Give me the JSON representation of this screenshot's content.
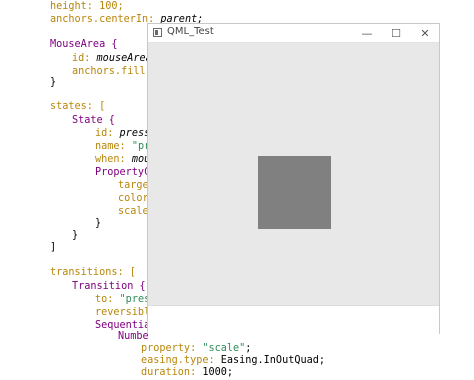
{
  "code": {
    "l1": "height: 100;",
    "l2a": "anchors.centerIn: ",
    "l2b": "parent;",
    "l3": "MouseArea {",
    "l4a": "id: ",
    "l4b": "mouseArea",
    "l5": "anchors.fill:",
    "l6": "}",
    "l7": "states: [",
    "l8": "State {",
    "l9a": "id: ",
    "l9b": "press",
    "l10a": "name: ",
    "l10b": "\"pr",
    "l11a": "when: ",
    "l11b": "mou",
    "l12": "PropertyC",
    "l13": "targe",
    "l14": "color",
    "l15": "scale",
    "l16": "}",
    "l17": "}",
    "l18": "]",
    "l19": "transitions: [",
    "l20": "Transition {",
    "l21a": "to: ",
    "l21b": "\"pres",
    "l22": "reversibl",
    "l23": "Sequentia",
    "l24": "Numbe",
    "l25a": "property: ",
    "l25b": "\"scale\"",
    "l25c": ";",
    "l26a": "easing.type: ",
    "l26b": "Easing.InOutQuad;",
    "l27a": "duration: ",
    "l27b": "1000;"
  },
  "window": {
    "title": "QML_Test",
    "minimize_glyph": "—",
    "maximize_glyph": "☐",
    "close_glyph": "✕"
  }
}
